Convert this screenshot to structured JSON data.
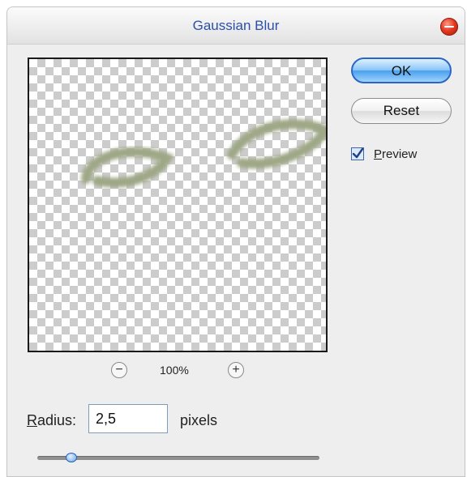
{
  "dialog": {
    "title": "Gaussian Blur",
    "close_icon": "close-icon"
  },
  "preview": {
    "zoom_out_icon": "zoom-out-icon",
    "zoom_out_glyph": "−",
    "zoom_label": "100%",
    "zoom_in_icon": "zoom-in-icon",
    "zoom_in_glyph": "+"
  },
  "buttons": {
    "ok_label": "OK",
    "reset_label": "Reset"
  },
  "preview_checkbox": {
    "checked": true,
    "label_first_letter": "P",
    "label_rest": "review"
  },
  "radius": {
    "label_first_letter": "R",
    "label_rest": "adius:",
    "value": "2,5",
    "units": "pixels",
    "slider_level": 0.12
  },
  "colors": {
    "accent": "#2a66c8",
    "title_text": "#2c4fa8",
    "blur_stroke": "#9ea786"
  }
}
